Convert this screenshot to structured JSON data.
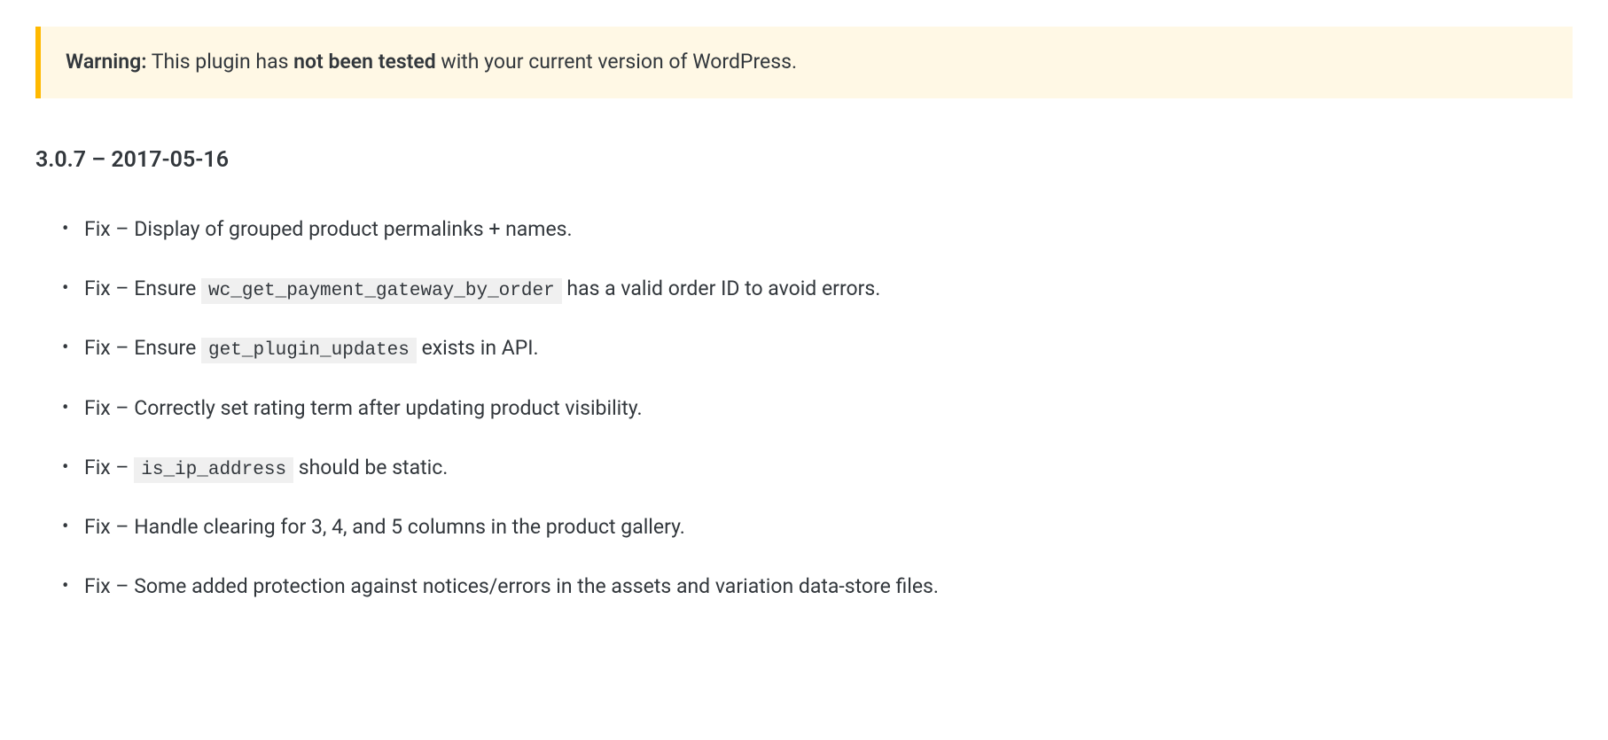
{
  "warning": {
    "prefix": "Warning:",
    "text_before": " This plugin has ",
    "bold_text": "not been tested",
    "text_after": " with your current version of WordPress."
  },
  "version_heading": "3.0.7 – 2017-05-16",
  "changelog": [
    {
      "segments": [
        {
          "type": "text",
          "value": "Fix – Display of grouped product permalinks + names."
        }
      ]
    },
    {
      "segments": [
        {
          "type": "text",
          "value": "Fix – Ensure "
        },
        {
          "type": "code",
          "value": "wc_get_payment_gateway_by_order"
        },
        {
          "type": "text",
          "value": " has a valid order ID to avoid errors."
        }
      ]
    },
    {
      "segments": [
        {
          "type": "text",
          "value": "Fix – Ensure "
        },
        {
          "type": "code",
          "value": "get_plugin_updates"
        },
        {
          "type": "text",
          "value": " exists in API."
        }
      ]
    },
    {
      "segments": [
        {
          "type": "text",
          "value": "Fix – Correctly set rating term after updating product visibility."
        }
      ]
    },
    {
      "segments": [
        {
          "type": "text",
          "value": "Fix – "
        },
        {
          "type": "code",
          "value": "is_ip_address"
        },
        {
          "type": "text",
          "value": " should be static."
        }
      ]
    },
    {
      "segments": [
        {
          "type": "text",
          "value": "Fix – Handle clearing for 3, 4, and 5 columns in the product gallery."
        }
      ]
    },
    {
      "segments": [
        {
          "type": "text",
          "value": "Fix – Some added protection against notices/errors in the assets and variation data-store files."
        }
      ]
    }
  ]
}
